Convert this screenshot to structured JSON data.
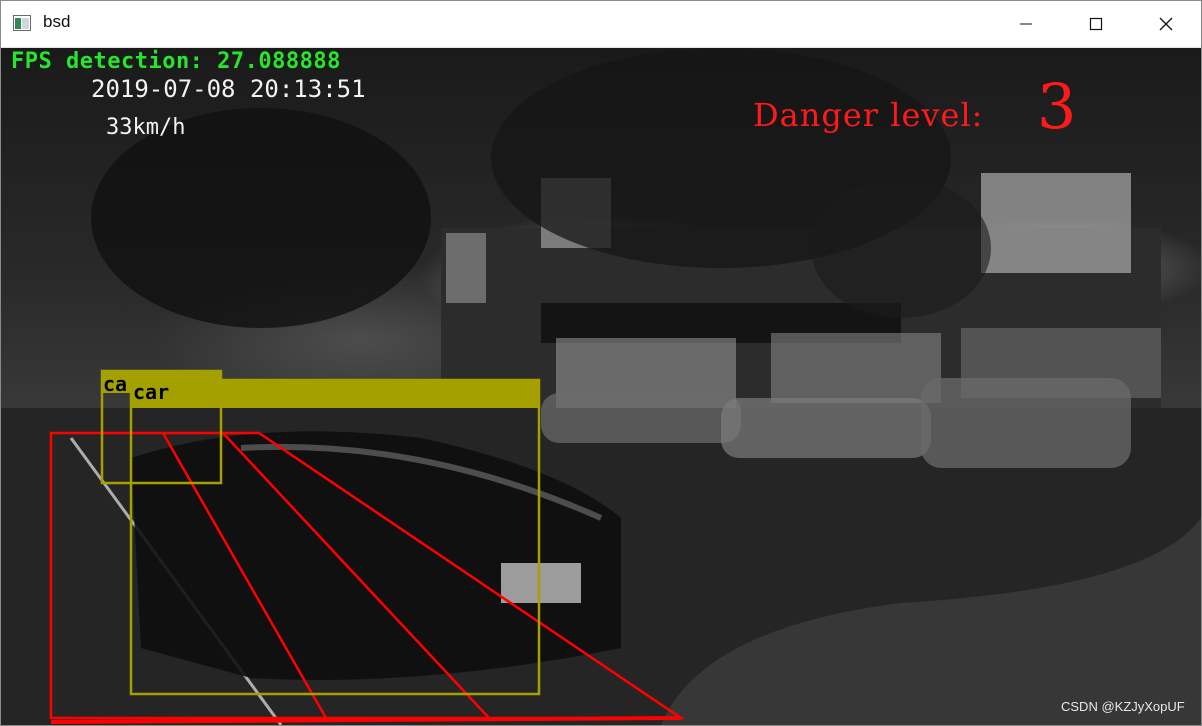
{
  "window": {
    "title": "bsd",
    "app_icon": "image-window-icon"
  },
  "controls": {
    "minimize": "minimize-icon",
    "maximize": "maximize-icon",
    "close": "close-icon"
  },
  "overlay": {
    "fps": "FPS detection: 27.088888",
    "datetime": "2019-07-08 20:13:51",
    "speed": "33km/h",
    "danger_label": "Danger level:",
    "danger_value": "3"
  },
  "detections": [
    {
      "label": "ca"
    },
    {
      "label": "car"
    }
  ],
  "watermark": "CSDN @KZJyXopUF",
  "colors": {
    "detection_box": "#a3a000",
    "danger": "#ff1a1a",
    "fps": "#27e52c",
    "zone": "#ff0000"
  }
}
